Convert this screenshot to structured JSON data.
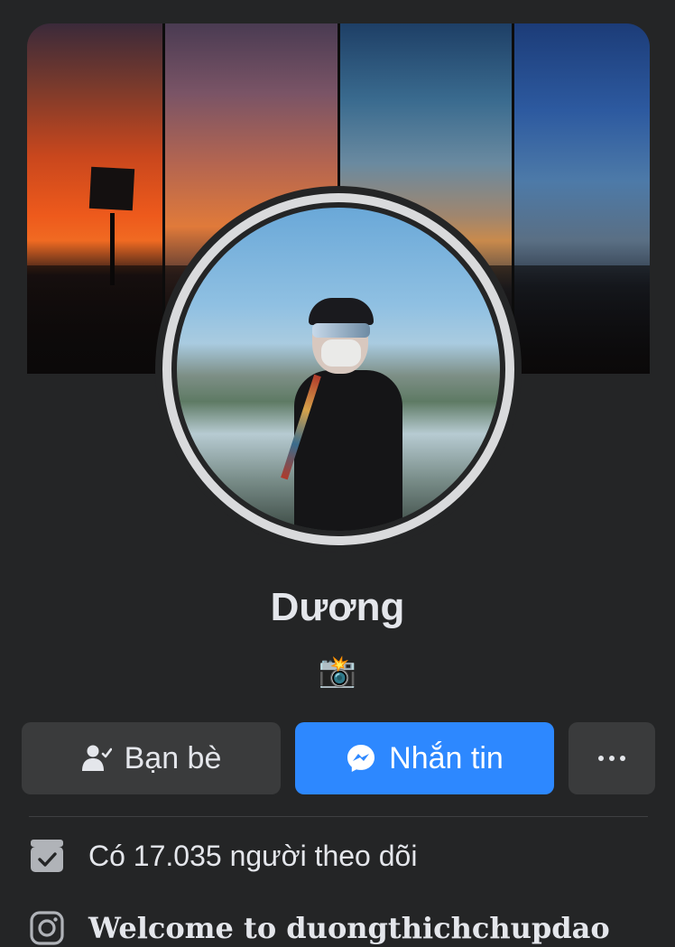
{
  "profile": {
    "name": "Dương",
    "bio_emoji": "📸"
  },
  "actions": {
    "friends_label": "Bạn bè",
    "message_label": "Nhắn tin"
  },
  "info": {
    "followers_text": "Có 17.035 người theo dõi",
    "instagram_text": "Welcome to duongthichchupdao"
  },
  "colors": {
    "background": "#242526",
    "button_secondary": "#3a3b3c",
    "button_primary": "#2d88ff",
    "text_primary": "#e4e6eb"
  },
  "icons": {
    "friends": "person-check-icon",
    "message": "messenger-icon",
    "more": "more-dots-icon",
    "followers": "follow-check-icon",
    "instagram": "instagram-icon"
  }
}
